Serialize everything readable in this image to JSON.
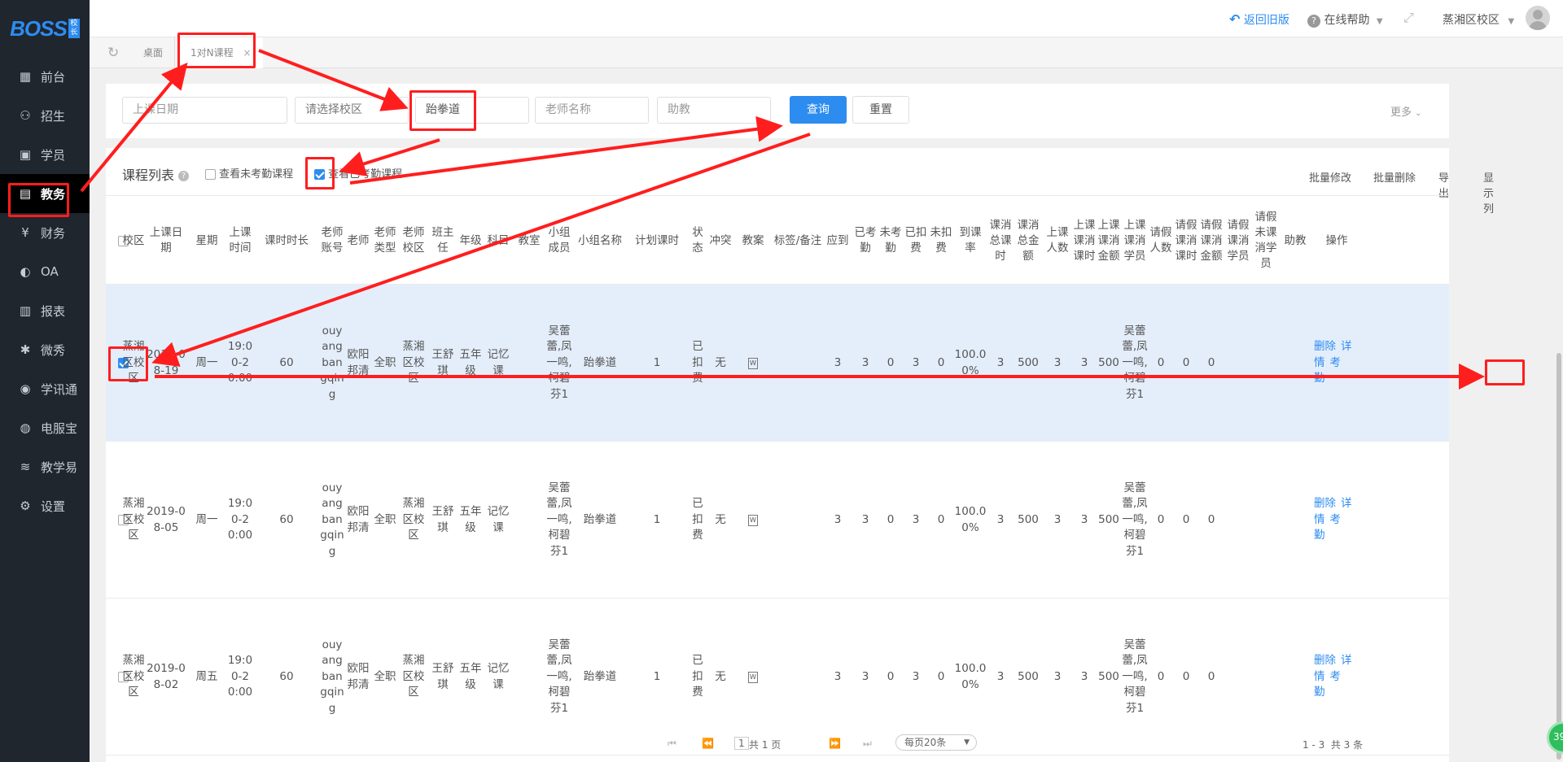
{
  "brand": {
    "logo": "BOSS",
    "logo_sub": "校长"
  },
  "sidebar": {
    "items": [
      {
        "label": "前台",
        "icon": "calendar-icon"
      },
      {
        "label": "招生",
        "icon": "user-add-icon"
      },
      {
        "label": "学员",
        "icon": "student-icon"
      },
      {
        "label": "教务",
        "icon": "board-icon",
        "active": true
      },
      {
        "label": "财务",
        "icon": "yen-icon"
      },
      {
        "label": "OA",
        "icon": "toggle-icon"
      },
      {
        "label": "报表",
        "icon": "bar-chart-icon"
      },
      {
        "label": "微秀",
        "icon": "weixiu-icon"
      },
      {
        "label": "学讯通",
        "icon": "location-icon"
      },
      {
        "label": "电服宝",
        "icon": "phone-icon"
      },
      {
        "label": "教学易",
        "icon": "book-icon"
      },
      {
        "label": "设置",
        "icon": "gear-icon"
      }
    ]
  },
  "topbar": {
    "back_old": "返回旧版",
    "help": "在线帮助",
    "campus": "蒸湘区校区"
  },
  "tabs": {
    "desk": "桌面",
    "current": "1对N课程"
  },
  "filter": {
    "date_placeholder": "上课日期",
    "campus_placeholder": "请选择校区",
    "course_value": "跆拳道",
    "teacher_placeholder": "老师名称",
    "assistant_placeholder": "助教",
    "query": "查询",
    "reset": "重置",
    "more": "更多"
  },
  "list": {
    "title": "课程列表",
    "unattended": "查看未考勤课程",
    "attended": "查看已考勤课程",
    "actions": [
      "批量修改",
      "批量删除",
      "导出",
      "显示列"
    ]
  },
  "columns": [
    "校区",
    "上课日期",
    "星期",
    "上课时间",
    "课时时长",
    "老师账号",
    "老师",
    "老师类型",
    "老师校区",
    "班主任",
    "年级",
    "科目",
    "教室",
    "小组成员",
    "小组名称",
    "计划课时",
    "状态",
    "冲突",
    "教案",
    "标签/备注",
    "应到",
    "已考勤",
    "未考勤",
    "已扣费",
    "未扣费",
    "到课率",
    "课消总课时",
    "课消总金额",
    "上课人数",
    "上课课消课时",
    "上课课消金额",
    "上课课消学员",
    "请假人数",
    "请假课消课时",
    "请假课消金额",
    "请假课消学员",
    "请假未课消学员",
    "助教",
    "操作"
  ],
  "rows": [
    {
      "selected": true,
      "campus": "蒸湘区校区",
      "date": "2019-08-19",
      "weekday": "周一",
      "time": "19:00-20:00",
      "duration": "60",
      "account": "ouyangbangqing",
      "teacher": "欧阳邦清",
      "type": "全职",
      "tcampus": "蒸湘区校区",
      "head": "王舒琪",
      "grade": "五年级",
      "subject": "记忆课",
      "room": "",
      "members": "吴蕾蕾,凤一鸣,柯碧芬1",
      "group": "跆拳道",
      "plan": "1",
      "status": "已扣费",
      "conflict": "无",
      "tag": "",
      "should": "3",
      "attended": "3",
      "unattended": "0",
      "charged": "3",
      "uncharged": "0",
      "rate": "100.00%",
      "total_hours": "3",
      "total_amount": "500",
      "class_count": "3",
      "class_hours": "3",
      "class_amount": "500",
      "class_students": "吴蕾蕾,凤一鸣,柯碧芬1",
      "leave_count": "0",
      "leave_hours": "0",
      "leave_amount": "0",
      "leave_students": "",
      "leave_unpaid": "",
      "assistant": "",
      "op_delete": "删除",
      "op_detail": "详情",
      "op_attend": "考勤"
    },
    {
      "selected": false,
      "campus": "蒸湘区校区",
      "date": "2019-08-05",
      "weekday": "周一",
      "time": "19:00-20:00",
      "duration": "60",
      "account": "ouyangbangqing",
      "teacher": "欧阳邦清",
      "type": "全职",
      "tcampus": "蒸湘区校区",
      "head": "王舒琪",
      "grade": "五年级",
      "subject": "记忆课",
      "room": "",
      "members": "吴蕾蕾,凤一鸣,柯碧芬1",
      "group": "跆拳道",
      "plan": "1",
      "status": "已扣费",
      "conflict": "无",
      "tag": "",
      "should": "3",
      "attended": "3",
      "unattended": "0",
      "charged": "3",
      "uncharged": "0",
      "rate": "100.00%",
      "total_hours": "3",
      "total_amount": "500",
      "class_count": "3",
      "class_hours": "3",
      "class_amount": "500",
      "class_students": "吴蕾蕾,凤一鸣,柯碧芬1",
      "leave_count": "0",
      "leave_hours": "0",
      "leave_amount": "0",
      "leave_students": "",
      "leave_unpaid": "",
      "assistant": "",
      "op_delete": "删除",
      "op_detail": "详情",
      "op_attend": "考勤"
    },
    {
      "selected": false,
      "campus": "蒸湘区校区",
      "date": "2019-08-02",
      "weekday": "周五",
      "time": "19:00-20:00",
      "duration": "60",
      "account": "ouyangbangqing",
      "teacher": "欧阳邦清",
      "type": "全职",
      "tcampus": "蒸湘区校区",
      "head": "王舒琪",
      "grade": "五年级",
      "subject": "记忆课",
      "room": "",
      "members": "吴蕾蕾,凤一鸣,柯碧芬1",
      "group": "跆拳道",
      "plan": "1",
      "status": "已扣费",
      "conflict": "无",
      "tag": "",
      "should": "3",
      "attended": "3",
      "unattended": "0",
      "charged": "3",
      "uncharged": "0",
      "rate": "100.00%",
      "total_hours": "3",
      "total_amount": "500",
      "class_count": "3",
      "class_hours": "3",
      "class_amount": "500",
      "class_students": "吴蕾蕾,凤一鸣,柯碧芬1",
      "leave_count": "0",
      "leave_hours": "0",
      "leave_amount": "0",
      "leave_students": "",
      "leave_unpaid": "",
      "assistant": "",
      "op_delete": "删除",
      "op_detail": "详情",
      "op_attend": "考勤"
    }
  ],
  "pager": {
    "page": "1",
    "total_pages": "共 1 页",
    "page_size": "每页20条",
    "summary": "1 - 3  共 3 条"
  },
  "float_badge": "39",
  "colors": {
    "accent": "#2d8cf0",
    "annotation": "#ff1e1e",
    "sidebar": "#20262e",
    "selected_row": "#e4eefb"
  }
}
